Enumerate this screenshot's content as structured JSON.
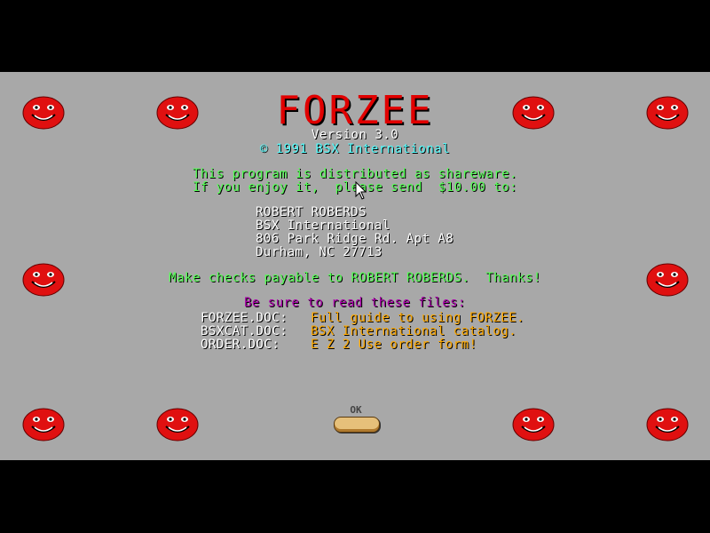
{
  "title": "FORZEE",
  "version": "Version 3.0",
  "copyright": "© 1991 BSX International",
  "shareware_line1": "This program is distributed as shareware.",
  "shareware_line2": "If you enjoy it,  please send  $10.00 to:",
  "address": {
    "line1": "ROBERT ROBERDS",
    "line2": "BSX International",
    "line3": "806 Park Ridge Rd. Apt A8",
    "line4": "Durham, NC 27713"
  },
  "checks_line": "Make checks payable to ROBERT ROBERDS.  Thanks!",
  "files_heading": "Be sure to read these files:",
  "files": [
    {
      "name": "FORZEE.DOC:",
      "desc": "Full guide to using FORZEE."
    },
    {
      "name": "BSXCAT.DOC:",
      "desc": "BSX International catalog."
    },
    {
      "name": "ORDER.DOC:",
      "desc": "E Z 2 Use order form!"
    }
  ],
  "ok_label": "OK",
  "colors": {
    "background": "#a8a8a8",
    "title": "#e00000",
    "text_white": "#ffffff",
    "text_green": "#55ff55",
    "text_cyan": "#55ffff",
    "text_magenta": "#aa00aa",
    "text_orange": "#ffaa00",
    "smiley": "#e01010"
  },
  "icons": [
    "smiley-face-icon",
    "mouse-cursor-icon"
  ]
}
